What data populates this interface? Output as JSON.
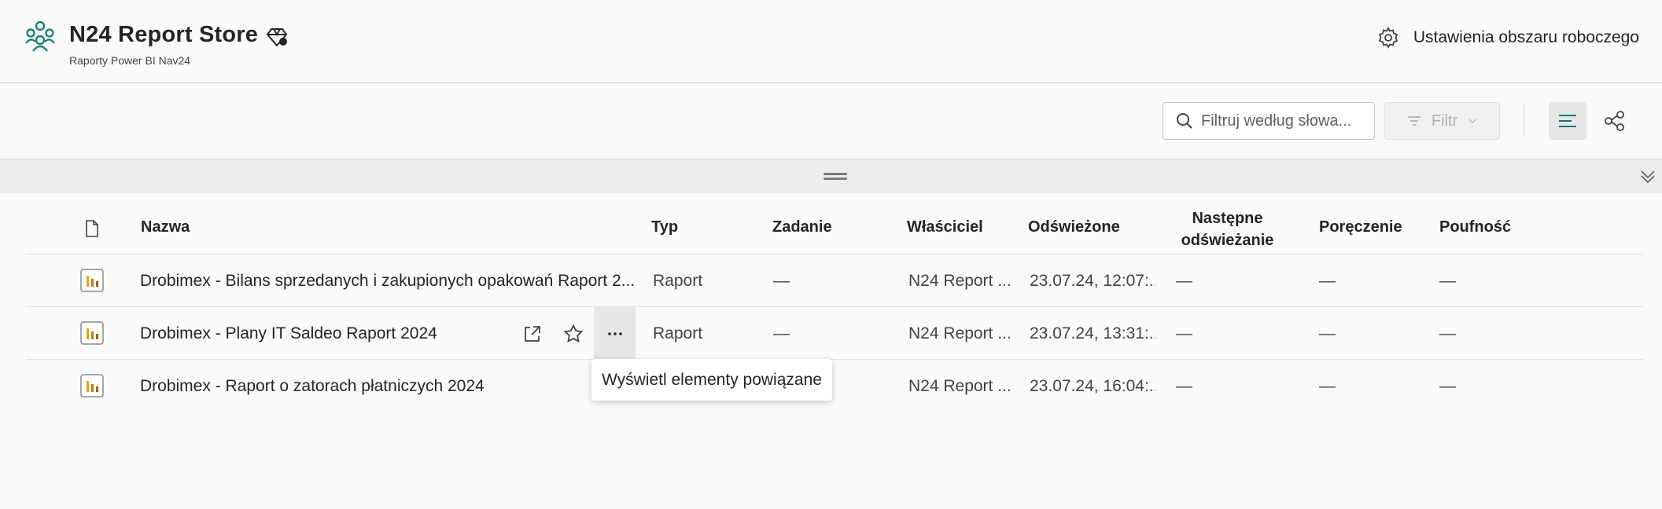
{
  "header": {
    "workspace_title": "N24 Report Store",
    "workspace_subtitle": "Raporty Power BI Nav24",
    "settings_label": "Ustawienia obszaru roboczego",
    "accent_color": "#0f7b6c"
  },
  "toolbar": {
    "search_placeholder": "Filtruj według słowa...",
    "filter_label": "Filtr"
  },
  "table": {
    "columns": {
      "name": "Nazwa",
      "type": "Typ",
      "task": "Zadanie",
      "owner": "Właściciel",
      "refreshed": "Odświeżone",
      "next_refresh_line1": "Następne",
      "next_refresh_line2": "odświeżanie",
      "endorsement": "Poręczenie",
      "sensitivity": "Poufność"
    },
    "rows": [
      {
        "name": "Drobimex - Bilans sprzedanych i zakupionych opakowań Raport 2...",
        "type": "Raport",
        "task": "—",
        "owner": "N24 Report ...",
        "refreshed": "23.07.24, 12:07:...",
        "next_refresh": "—",
        "endorsement": "—",
        "sensitivity": "—"
      },
      {
        "name": "Drobimex - Plany IT Saldeo Raport 2024",
        "type": "Raport",
        "task": "—",
        "owner": "N24 Report ...",
        "refreshed": "23.07.24, 13:31:...",
        "next_refresh": "—",
        "endorsement": "—",
        "sensitivity": "—"
      },
      {
        "name": "Drobimex - Raport o zatorach płatniczych 2024",
        "type": "",
        "task": "",
        "owner": "N24 Report ...",
        "refreshed": "23.07.24, 16:04:...",
        "next_refresh": "—",
        "endorsement": "—",
        "sensitivity": "—"
      }
    ]
  },
  "tooltip": {
    "text": "Wyświetl elementy powiązane"
  }
}
